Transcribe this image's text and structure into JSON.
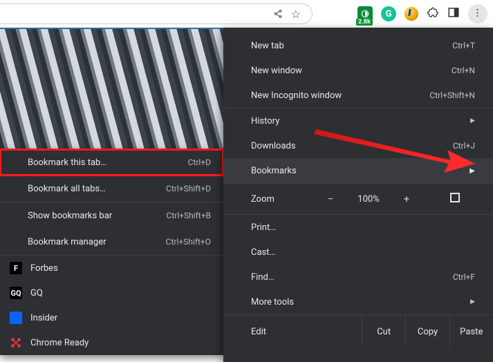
{
  "toolbar": {
    "ext_badge": "2.8k"
  },
  "submenu": {
    "bookmark_tab": {
      "label": "Bookmark this tab…",
      "shortcut": "Ctrl+D"
    },
    "bookmark_all": {
      "label": "Bookmark all tabs…",
      "shortcut": "Ctrl+Shift+D"
    },
    "show_bar": {
      "label": "Show bookmarks bar",
      "shortcut": "Ctrl+Shift+B"
    },
    "manager": {
      "label": "Bookmark manager",
      "shortcut": "Ctrl+Shift+O"
    },
    "bookmarks": [
      {
        "label": "Forbes"
      },
      {
        "label": "GQ"
      },
      {
        "label": "Insider"
      },
      {
        "label": "Chrome Ready"
      }
    ]
  },
  "menu": {
    "new_tab": {
      "label": "New tab",
      "shortcut": "Ctrl+T"
    },
    "new_window": {
      "label": "New window",
      "shortcut": "Ctrl+N"
    },
    "incognito": {
      "label": "New Incognito window",
      "shortcut": "Ctrl+Shift+N"
    },
    "history": {
      "label": "History"
    },
    "downloads": {
      "label": "Downloads",
      "shortcut": "Ctrl+J"
    },
    "bookmarks": {
      "label": "Bookmarks"
    },
    "zoom": {
      "label": "Zoom",
      "level": "100%",
      "minus": "−",
      "plus": "+"
    },
    "print": {
      "label": "Print…"
    },
    "cast": {
      "label": "Cast…"
    },
    "find": {
      "label": "Find…",
      "shortcut": "Ctrl+F"
    },
    "more_tools": {
      "label": "More tools"
    },
    "edit": {
      "label": "Edit",
      "cut": "Cut",
      "copy": "Copy",
      "paste": "Paste"
    }
  }
}
